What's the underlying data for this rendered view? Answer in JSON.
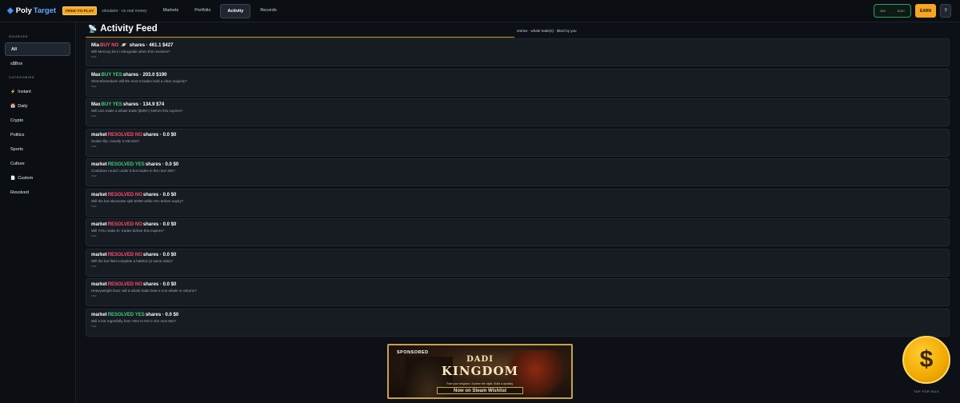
{
  "app": {
    "logo_mark": "◆",
    "logo_poly": "Poly",
    "logo_target": "Target",
    "badge": "FREE-TO-PLAY",
    "mode_text": "simulator · no real money"
  },
  "nav": [
    {
      "label": "Markets",
      "active": false
    },
    {
      "label": "Portfolio",
      "active": false
    },
    {
      "label": "Activity",
      "active": true
    },
    {
      "label": "Records",
      "active": false
    }
  ],
  "header_right": {
    "balance_left": "$50",
    "balance_right": "$150",
    "earn_label": "EARN",
    "help_label": "?"
  },
  "sidebar": {
    "sources_heading": "SOURCES",
    "sources": [
      {
        "label": "All",
        "icon": "",
        "active": true
      },
      {
        "label": "s$Box",
        "icon": "",
        "active": false
      }
    ],
    "categories_heading": "CATEGORIES",
    "categories": [
      {
        "label": "Instant",
        "icon": "⚡",
        "icon_name": "lightning-icon"
      },
      {
        "label": "Daily",
        "icon": "📅",
        "icon_name": "calendar-icon"
      },
      {
        "label": "Crypto",
        "icon": "",
        "icon_name": ""
      },
      {
        "label": "Politics",
        "icon": "",
        "icon_name": ""
      },
      {
        "label": "Sports",
        "icon": "",
        "icon_name": ""
      },
      {
        "label": "Culture",
        "icon": "",
        "icon_name": ""
      },
      {
        "label": "Custom",
        "icon": "📄",
        "icon_name": "document-icon"
      },
      {
        "label": "Resolved",
        "icon": "",
        "icon_name": ""
      }
    ]
  },
  "feed": {
    "title_icon": "📡",
    "title": "Activity Feed",
    "meta": "entries · whale trade(s) · $610 by you",
    "items": [
      {
        "actor": "Mia",
        "action": "BUY NO",
        "side": "no",
        "extra": "🪐",
        "rest": "shares · 461.1 $427",
        "question": "Will Mercury be in retrograde when this resolves?",
        "sub": "now"
      },
      {
        "actor": "Max",
        "action": "BUY YES",
        "side": "yes",
        "extra": "",
        "rest": "shares · 203.0 $190",
        "question": "Shmreferendum! will the next 5 trades hold a clear majority?",
        "sub": "now"
      },
      {
        "actor": "Max",
        "action": "BUY YES",
        "side": "yes",
        "extra": "",
        "rest": "shares · 134.9 $74",
        "question": "Will Liss make a whale trade ($300+) before this expires?",
        "sub": "now"
      },
      {
        "actor": "market",
        "action": "RESOLVED NO",
        "side": "no",
        "extra": "",
        "rest": "shares · 0.0 $0",
        "question": "Snakin flip: exactly 3 HEADS?",
        "sub": "now"
      },
      {
        "actor": "market",
        "action": "RESOLVED YES",
        "side": "yes",
        "extra": "",
        "rest": "shares · 0.0 $0",
        "question": "Cooldown round: under 8 bot trades in the next 30s?",
        "sub": "now"
      },
      {
        "actor": "market",
        "action": "RESOLVED NO",
        "side": "no",
        "extra": "",
        "rest": "shares · 0.0 $0",
        "question": "Will the bot electorate split 50/50 within 5% before expiry?",
        "sub": "now"
      },
      {
        "actor": "market",
        "action": "RESOLVED NO",
        "side": "no",
        "extra": "",
        "rest": "shares · 0.0 $0",
        "question": "Will YOU make 5+ trades before this expires?",
        "sub": "now"
      },
      {
        "actor": "market",
        "action": "RESOLVED NO",
        "side": "no",
        "extra": "",
        "rest": "shares · 0.0 $0",
        "question": "Will the bot field complete a hattrick (3 same-side)?",
        "sub": "now"
      },
      {
        "actor": "market",
        "action": "RESOLVED NO",
        "side": "no",
        "extra": "",
        "rest": "shares · 0.0 $0",
        "question": "Heavyweight bout: will a whale trade beat a non-whale in volume?",
        "sub": "now"
      },
      {
        "actor": "market",
        "action": "RESOLVED YES",
        "side": "yes",
        "extra": "",
        "rest": "shares · 0.0 $0",
        "question": "Will a bot regretfully from YES to NO in the next 50s?",
        "sub": "now"
      }
    ]
  },
  "ad": {
    "sponsored": "SPONSORED",
    "title_line1": "DADI",
    "title_line2": "KINGDOM",
    "tagline": "Rule your kingdom. Survive the night. Build a dynasty.",
    "cta": "Now on Steam Wishlist"
  },
  "coin": {
    "symbol": "$",
    "label": "TAP FOR BUX"
  },
  "colors": {
    "accent_gold": "#f5a623",
    "yes_green": "#3ecf7a",
    "no_red": "#ff4d6d"
  }
}
